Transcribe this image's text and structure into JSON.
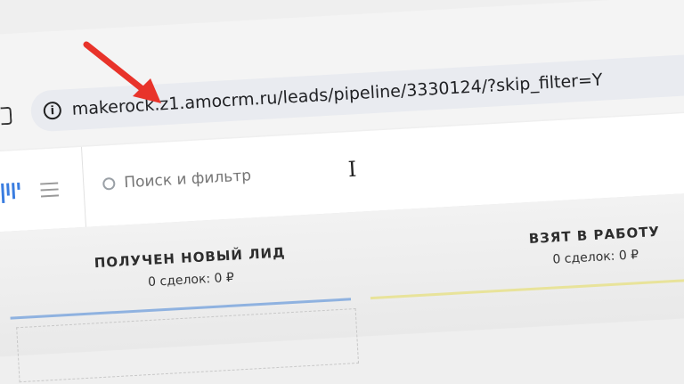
{
  "browser": {
    "url": "makerock.z1.amocrm.ru/leads/pipeline/3330124/?skip_filter=Y",
    "info_icon_glyph": "i"
  },
  "header": {
    "search_placeholder": "Поиск и фильтр",
    "text_cursor_glyph": "I"
  },
  "stages": [
    {
      "title": "ПОЛУЧЕН НОВЫЙ ЛИД",
      "count": "0 сделок: 0 ₽",
      "color": "#8fb2e0"
    },
    {
      "title": "ВЗЯТ В РАБОТУ",
      "count": "0 сделок: 0 ₽",
      "color": "#e8e39a"
    }
  ],
  "colors": {
    "accent_arrow": "#e8332a",
    "pipeline_icon": "#3a7de0"
  }
}
